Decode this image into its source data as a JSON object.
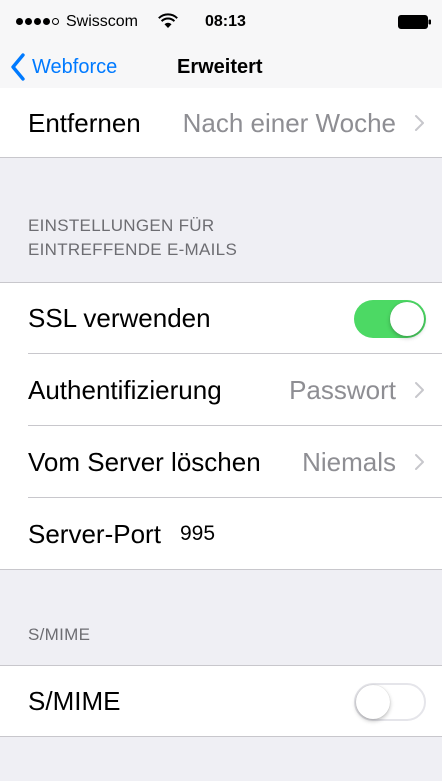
{
  "status_bar": {
    "carrier": "Swisscom",
    "time": "08:13",
    "signal_bars_filled": 4,
    "signal_bars_total": 5
  },
  "nav": {
    "back_label": "Webforce",
    "title": "Erweitert"
  },
  "rows": {
    "entfernen": {
      "label": "Entfernen",
      "value": "Nach einer Woche"
    },
    "ssl": {
      "label": "SSL verwenden",
      "enabled": true
    },
    "auth": {
      "label": "Authentifizierung",
      "value": "Passwort"
    },
    "delete_from_server": {
      "label": "Vom Server löschen",
      "value": "Niemals"
    },
    "server_port": {
      "label": "Server-Port",
      "value": "995"
    },
    "smime": {
      "label": "S/MIME",
      "enabled": false
    }
  },
  "sections": {
    "incoming": {
      "line1": "EINSTELLUNGEN FÜR",
      "line2": "EINTREFFENDE E-MAILS"
    },
    "smime": {
      "header": "S/MIME"
    }
  },
  "colors": {
    "accent": "#007aff",
    "toggle_on": "#4cd964",
    "secondary_text": "#8e8e93",
    "header_text": "#6d6d72",
    "background": "#efeff4"
  }
}
